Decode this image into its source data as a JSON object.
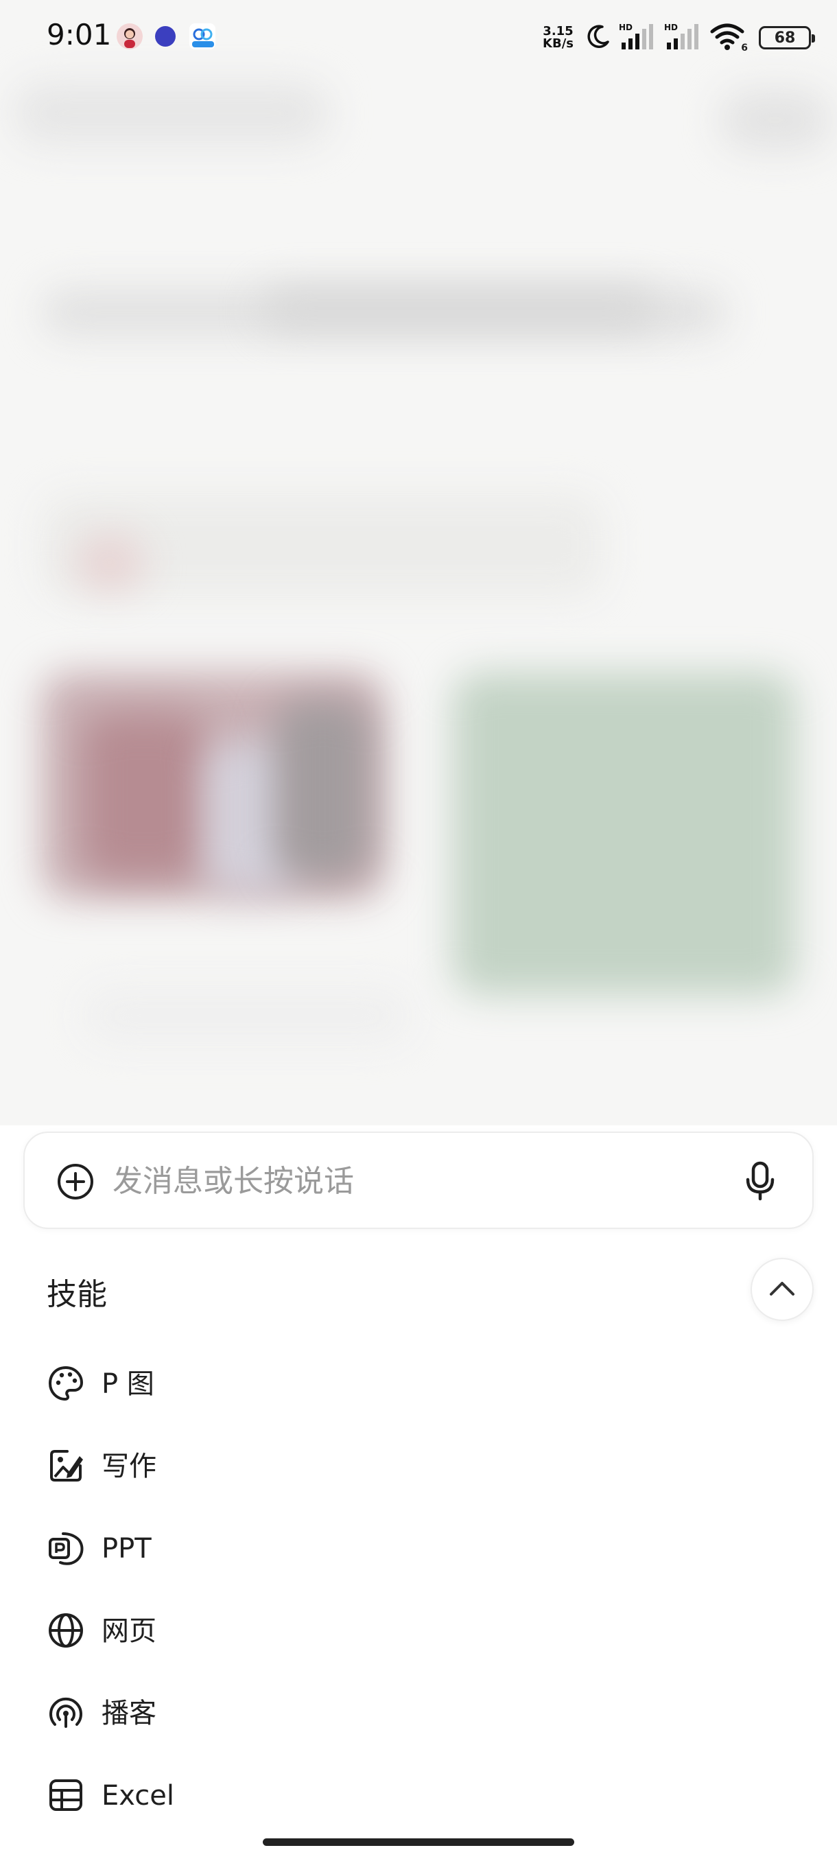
{
  "status_bar": {
    "time": "9:01",
    "net_speed_value": "3.15",
    "net_speed_unit": "KB/s",
    "sim1_label": "HD",
    "sim2_label": "HD",
    "wifi_badge": "6",
    "battery": "68"
  },
  "input": {
    "placeholder": "发消息或长按说话"
  },
  "skills": {
    "title": "技能",
    "items": [
      {
        "label": "P 图",
        "icon": "palette-icon"
      },
      {
        "label": "写作",
        "icon": "image-edit-icon"
      },
      {
        "label": "PPT",
        "icon": "ppt-icon"
      },
      {
        "label": "网页",
        "icon": "globe-icon"
      },
      {
        "label": "播客",
        "icon": "podcast-icon"
      },
      {
        "label": "Excel",
        "icon": "table-icon"
      }
    ]
  },
  "colors": {
    "text_primary": "#1f1f1f",
    "placeholder": "#9a9a9a",
    "border": "#ececec"
  }
}
